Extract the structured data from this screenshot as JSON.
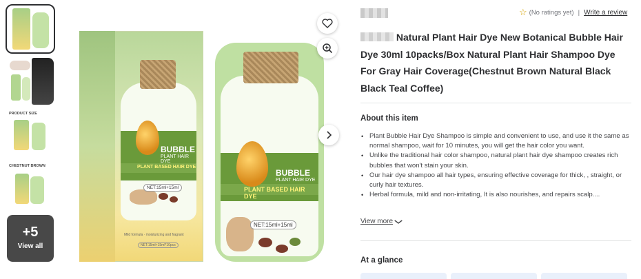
{
  "thumbnails": {
    "items": [
      {
        "caption": ""
      },
      {
        "caption": ""
      },
      {
        "caption": "PRODUCT SIZE"
      },
      {
        "caption": "CHESTNUT BROWN"
      }
    ],
    "view_all": {
      "count": "+5",
      "label": "View all"
    }
  },
  "product_image": {
    "box_label": {
      "line1": "BUBBLE",
      "line2": "PLANT HAIR DYE",
      "line3": "PLANT BASED HAIR DYE",
      "net": "NET:15ml+15ml",
      "box_net": "NET:15ml+15ml*10pcs",
      "mild": "Mild formula · moisturizing and fragrant"
    },
    "sachet_label": {
      "line1": "BUBBLE",
      "line2": "PLANT HAIR DYE",
      "line3": "PLANT BASED HAIR DYE",
      "net": "NET:15ml+15ml"
    }
  },
  "actions": {
    "favorite_icon": "heart-icon",
    "zoom_icon": "zoom-in-icon",
    "next_icon": "chevron-right-icon"
  },
  "rating": {
    "text": "(No ratings yet)",
    "separator": "|",
    "write_review": "Write a review"
  },
  "title": {
    "text": "Natural Plant Hair Dye New Botanical Bubble Hair Dye 30ml 10packs/Box Natural Plant Hair Shampoo Dye For Gray Hair Coverage(Chestnut Brown Natural Black Black Teal Coffee)"
  },
  "about": {
    "heading": "About this item",
    "bullets": [
      "Plant Bubble Hair Dye Shampoo is simple and convenient to use, and use it the same as normal shampoo, wait for 10 minutes, you will get the hair color you want.",
      "Unlike the traditional hair color shampoo, natural plant hair dye shampoo creates rich bubbles that won't stain your skin.",
      "Our hair dye shampoo all hair types, ensuring effective coverage for thick, , straight, or curly hair textures.",
      "Herbal formula, mild and non-irritating, It is also nourishes, and repairs scalp...."
    ],
    "view_more": "View more"
  },
  "glance": {
    "heading": "At a glance"
  },
  "colors": {
    "text": "#2e2f32",
    "muted": "#74767c",
    "star": "#d6a300",
    "divider": "#e3e4e5",
    "label_green": "#6a9a3a"
  }
}
